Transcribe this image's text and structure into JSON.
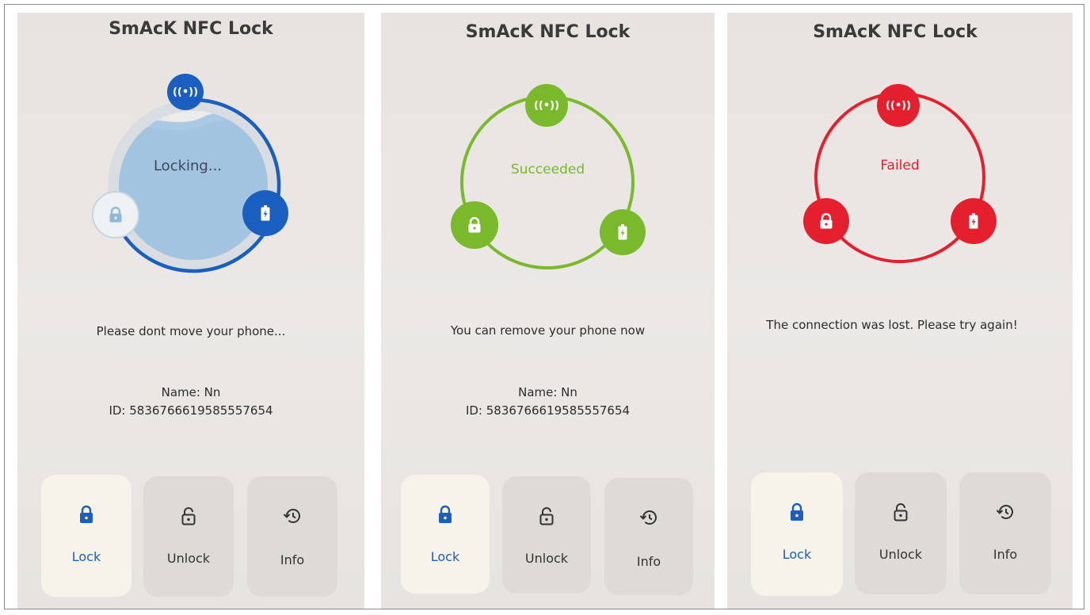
{
  "screens": [
    {
      "app_title": "SmAcK NFC Lock",
      "status": "Locking...",
      "message": "Please dont move your phone...",
      "device_name": "Name: Nn",
      "device_id": "ID: 5836766619585557654",
      "state": "in-progress",
      "accent": "#1a5fc0",
      "nav": [
        {
          "label": "Lock",
          "icon": "lock-icon",
          "active": true
        },
        {
          "label": "Unlock",
          "icon": "lock-open-icon",
          "active": false
        },
        {
          "label": "Info",
          "icon": "history-icon",
          "active": false
        }
      ]
    },
    {
      "app_title": "SmAcK NFC Lock",
      "status": "Succeeded",
      "message": "You can remove your phone now",
      "device_name": "Name: Nn",
      "device_id": "ID: 5836766619585557654",
      "state": "success",
      "accent": "#7ab82c",
      "nav": [
        {
          "label": "Lock",
          "icon": "lock-icon",
          "active": true
        },
        {
          "label": "Unlock",
          "icon": "lock-open-icon",
          "active": false
        },
        {
          "label": "Info",
          "icon": "history-icon",
          "active": false
        }
      ]
    },
    {
      "app_title": "SmAcK NFC Lock",
      "status": "Failed",
      "message": "The connection was lost. Please try again!",
      "state": "failed",
      "accent": "#e5202e",
      "nav": [
        {
          "label": "Lock",
          "icon": "lock-icon",
          "active": true
        },
        {
          "label": "Unlock",
          "icon": "lock-open-icon",
          "active": false
        },
        {
          "label": "Info",
          "icon": "history-icon",
          "active": false
        }
      ]
    }
  ]
}
